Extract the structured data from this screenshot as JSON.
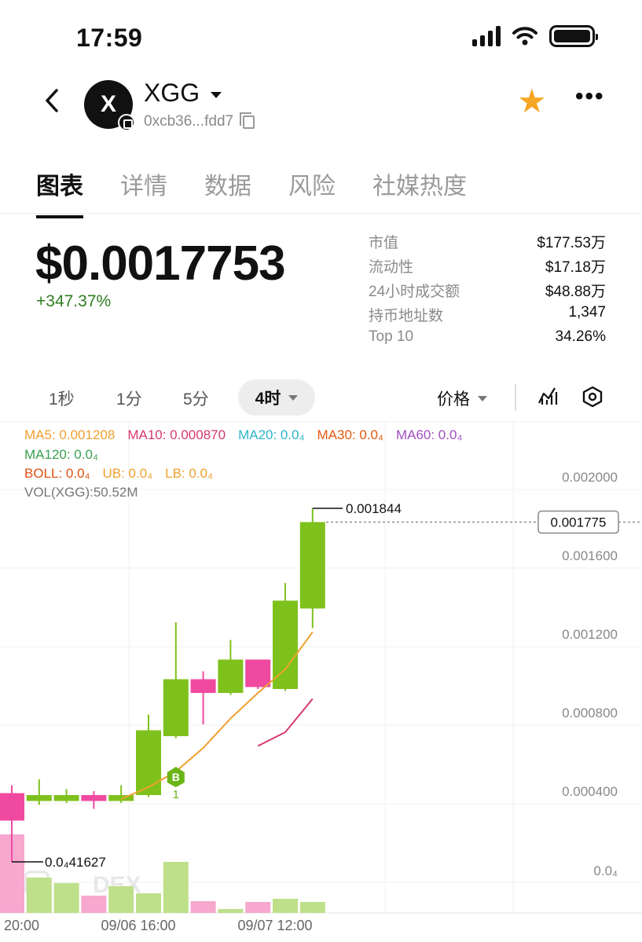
{
  "status_bar": {
    "time": "17:59"
  },
  "header": {
    "avatar_letter": "X",
    "token_name": "XGG",
    "address": "0xcb36...fdd7"
  },
  "tabs": [
    {
      "label": "图表",
      "active": true
    },
    {
      "label": "详情",
      "active": false
    },
    {
      "label": "数据",
      "active": false
    },
    {
      "label": "风险",
      "active": false
    },
    {
      "label": "社媒热度",
      "active": false
    }
  ],
  "price": {
    "value": "$0.0017753",
    "change": "+347.37%"
  },
  "stats": [
    {
      "key": "市值",
      "value": "$177.53万"
    },
    {
      "key": "流动性",
      "value": "$17.18万"
    },
    {
      "key": "24小时成交额",
      "value": "$48.88万"
    },
    {
      "key": "持币地址数",
      "value": "1,347"
    },
    {
      "key": "Top 10",
      "value": "34.26%"
    }
  ],
  "intervals": {
    "options": [
      "1秒",
      "1分",
      "5分"
    ],
    "active": "4时",
    "price_mode": "价格"
  },
  "indicators": {
    "ma5": "MA5: 0.001208",
    "ma10": "MA10: 0.000870",
    "ma20": "MA20: 0.0₄",
    "ma30": "MA30: 0.0₄",
    "ma60": "MA60: 0.0₄",
    "ma120": "MA120: 0.0₄",
    "boll": "BOLL: 0.0₄",
    "ub": "UB: 0.0₄",
    "lb": "LB: 0.0₄",
    "vol": "VOL(XGG):50.52M"
  },
  "colors": {
    "up": "#7fc11c",
    "down": "#f04aa0",
    "ma5": "#f0a030",
    "ma10": "#d63a6a",
    "ma20": "#2ab5c8",
    "ma30": "#e05a10",
    "ma60": "#a050c0",
    "ma120": "#3aa050",
    "boll": "#e05010",
    "ub": "#f0a030",
    "lb": "#f0a030",
    "vol": "#777777",
    "star": "#f5a623",
    "change": "#2e7d1f"
  },
  "chart_data": {
    "type": "candlestick",
    "y_ticks": [
      "0.002000",
      "0.001600",
      "0.001200",
      "0.000800",
      "0.000400",
      "0.0₄"
    ],
    "ylim": [
      0,
      0.0022
    ],
    "x_tick_labels": [
      "20:00",
      "09/06 16:00",
      "09/07 12:00"
    ],
    "high_label": "0.001844",
    "low_label": "0.0₄41627",
    "current_price_label": "0.001775",
    "watermark": "DEX",
    "marker": {
      "letter": "B",
      "count": "1"
    },
    "candles": [
      {
        "o": 0.00039,
        "c": 0.00025,
        "h": 0.00043,
        "l": 4e-05,
        "vol": 1.0
      },
      {
        "o": 0.00035,
        "c": 0.00038,
        "h": 0.00046,
        "l": 0.00033,
        "vol": 0.45
      },
      {
        "o": 0.00035,
        "c": 0.00038,
        "h": 0.00041,
        "l": 0.00034,
        "vol": 0.38
      },
      {
        "o": 0.00038,
        "c": 0.00035,
        "h": 0.0004,
        "l": 0.00031,
        "vol": 0.22
      },
      {
        "o": 0.00035,
        "c": 0.00038,
        "h": 0.00043,
        "l": 0.00034,
        "vol": 0.34
      },
      {
        "o": 0.00038,
        "c": 0.00071,
        "h": 0.00079,
        "l": 0.00037,
        "vol": 0.25
      },
      {
        "o": 0.00068,
        "c": 0.00097,
        "h": 0.00126,
        "l": 0.00067,
        "vol": 0.65
      },
      {
        "o": 0.00097,
        "c": 0.0009,
        "h": 0.00101,
        "l": 0.00074,
        "vol": 0.15
      },
      {
        "o": 0.0009,
        "c": 0.00107,
        "h": 0.00117,
        "l": 0.00089,
        "vol": 0.05
      },
      {
        "o": 0.00107,
        "c": 0.00093,
        "h": 0.00107,
        "l": 0.00092,
        "vol": 0.14
      },
      {
        "o": 0.00092,
        "c": 0.00137,
        "h": 0.00146,
        "l": 0.00091,
        "vol": 0.18
      },
      {
        "o": 0.00133,
        "c": 0.00177,
        "h": 0.00184,
        "l": 0.00123,
        "vol": 0.14
      }
    ],
    "ma5": [
      null,
      null,
      null,
      null,
      0.00036,
      0.00042,
      0.0005,
      0.00062,
      0.00077,
      0.0009,
      0.00102,
      0.00121
    ],
    "ma10": [
      null,
      null,
      null,
      null,
      null,
      null,
      null,
      null,
      null,
      0.00063,
      0.0007,
      0.00087
    ]
  }
}
